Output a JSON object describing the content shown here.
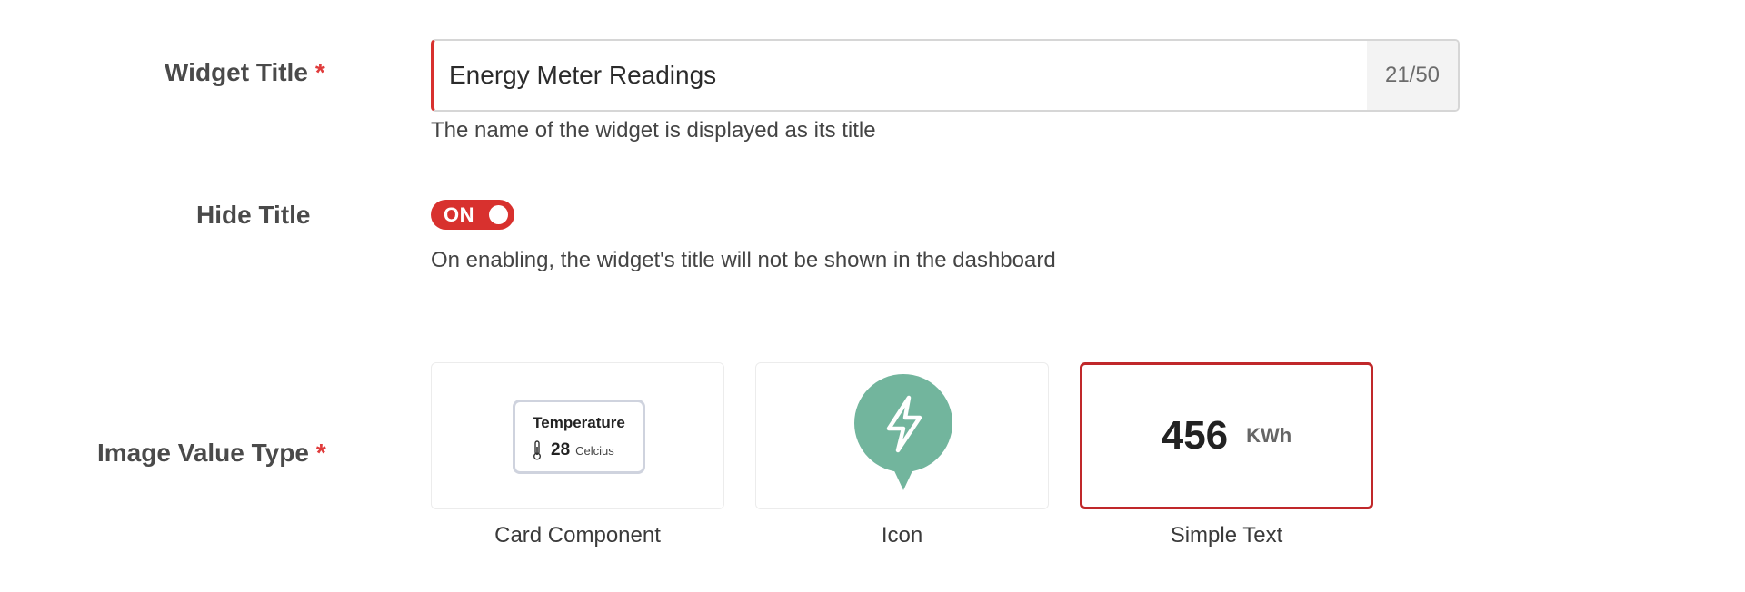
{
  "widget_title": {
    "label": "Widget Title",
    "required_mark": "*",
    "value": "Energy Meter Readings",
    "char_count": "21/50",
    "help": "The name of the widget is displayed as its title"
  },
  "hide_title": {
    "label": "Hide Title",
    "toggle_state": "ON",
    "help": "On enabling, the widget's title will not be shown in the dashboard"
  },
  "image_value_type": {
    "label": "Image Value Type",
    "required_mark": "*",
    "options": [
      {
        "label": "Card Component",
        "preview": {
          "title": "Temperature",
          "icon": "thermometer-icon",
          "value": "28",
          "unit": "Celcius"
        }
      },
      {
        "label": "Icon",
        "preview": {
          "icon": "lightning-bolt-icon",
          "color": "#72b59d"
        }
      },
      {
        "label": "Simple Text",
        "preview": {
          "value": "456",
          "unit": "KWh"
        },
        "selected": true
      }
    ]
  },
  "colors": {
    "accent": "#d8312e",
    "selected_border": "#c0282a",
    "icon_pin": "#72b59d"
  }
}
